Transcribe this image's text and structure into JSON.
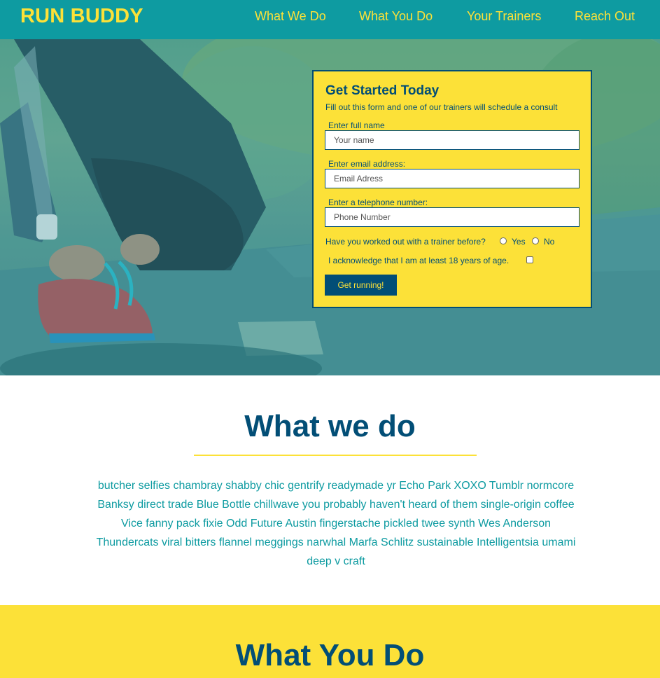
{
  "header": {
    "logo": "RUN BUDDY",
    "nav": [
      "What We Do",
      "What You Do",
      "Your Trainers",
      "Reach Out"
    ]
  },
  "form": {
    "title": "Get Started Today",
    "subtitle": "Fill out this form and one of our trainers will schedule a consult",
    "name_label": "Enter full name",
    "name_placeholder": "Your name",
    "email_label": "Enter email address:",
    "email_placeholder": "Email Adress",
    "phone_label": "Enter a telephone number:",
    "phone_placeholder": "Phone Number",
    "trainer_question": "Have you worked out with a trainer before?",
    "yes_label": "Yes",
    "no_label": "No",
    "acknowledge": "I acknowledge that I am at least 18 years of age.",
    "submit": "Get running!"
  },
  "what_we_do": {
    "title": "What we do",
    "text": "butcher selfies chambray shabby chic gentrify readymade yr Echo Park XOXO Tumblr normcore Banksy direct trade Blue Bottle chillwave you probably haven't heard of them single-origin coffee Vice fanny pack fixie Odd Future Austin fingerstache pickled twee synth Wes Anderson Thundercats viral bitters flannel meggings narwhal Marfa Schlitz sustainable Intelligentsia umami deep v craft"
  },
  "what_you_do": {
    "title": "What You Do"
  },
  "colors": {
    "brand_teal": "#0e9ba1",
    "brand_yellow": "#fce138",
    "brand_navy": "#024e76"
  }
}
